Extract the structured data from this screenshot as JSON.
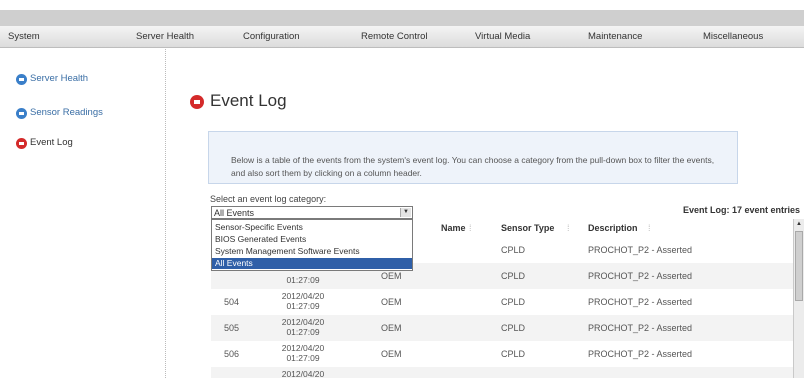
{
  "nav": {
    "items": [
      "System",
      "Server Health",
      "Configuration",
      "Remote Control",
      "Virtual Media",
      "Maintenance",
      "Miscellaneous"
    ]
  },
  "sidebar": {
    "items": [
      {
        "label": "Server Health"
      },
      {
        "label": "Sensor Readings"
      },
      {
        "label": "Event Log"
      }
    ]
  },
  "main": {
    "title": "Event Log",
    "info_text": "Below is a table of the events from the system's event log. You can choose a category from the pull-down box to filter the events, and also sort them by clicking on a column header.",
    "select_label": "Select an event log category:",
    "select_value": "All Events",
    "select_options": [
      "Sensor-Specific Events",
      "BIOS Generated Events",
      "System Management Software Events",
      "All Events"
    ],
    "event_count": "Event Log: 17 event entries"
  },
  "table": {
    "headers": [
      "Name",
      "Sensor Type",
      "Description"
    ],
    "rows": [
      {
        "id": "",
        "time1": "",
        "time2": "",
        "name": "",
        "stype": "CPLD",
        "desc": "PROCHOT_P2 - Asserted"
      },
      {
        "id": "",
        "time1": "",
        "time2": "01:27:09",
        "name": "OEM",
        "stype": "CPLD",
        "desc": "PROCHOT_P2 - Asserted"
      },
      {
        "id": "504",
        "time1": "2012/04/20",
        "time2": "01:27:09",
        "name": "OEM",
        "stype": "CPLD",
        "desc": "PROCHOT_P2 - Asserted"
      },
      {
        "id": "505",
        "time1": "2012/04/20",
        "time2": "01:27:09",
        "name": "OEM",
        "stype": "CPLD",
        "desc": "PROCHOT_P2 - Asserted"
      },
      {
        "id": "506",
        "time1": "2012/04/20",
        "time2": "01:27:09",
        "name": "OEM",
        "stype": "CPLD",
        "desc": "PROCHOT_P2 - Asserted"
      },
      {
        "id": "",
        "time1": "2012/04/20",
        "time2": "",
        "name": "",
        "stype": "",
        "desc": ""
      }
    ]
  },
  "colors": {
    "link_blue": "#3a6ea5",
    "icon_red": "#d42a2a",
    "icon_blue": "#3a7fc9",
    "selected_option": "#2f5fa8",
    "info_box_bg": "#eef3fa"
  },
  "icons": {
    "sidebar_bullet": "arrow-circle-icon",
    "select_arrow": "chevron-down-icon",
    "scroll_up": "scroll-up-icon"
  }
}
